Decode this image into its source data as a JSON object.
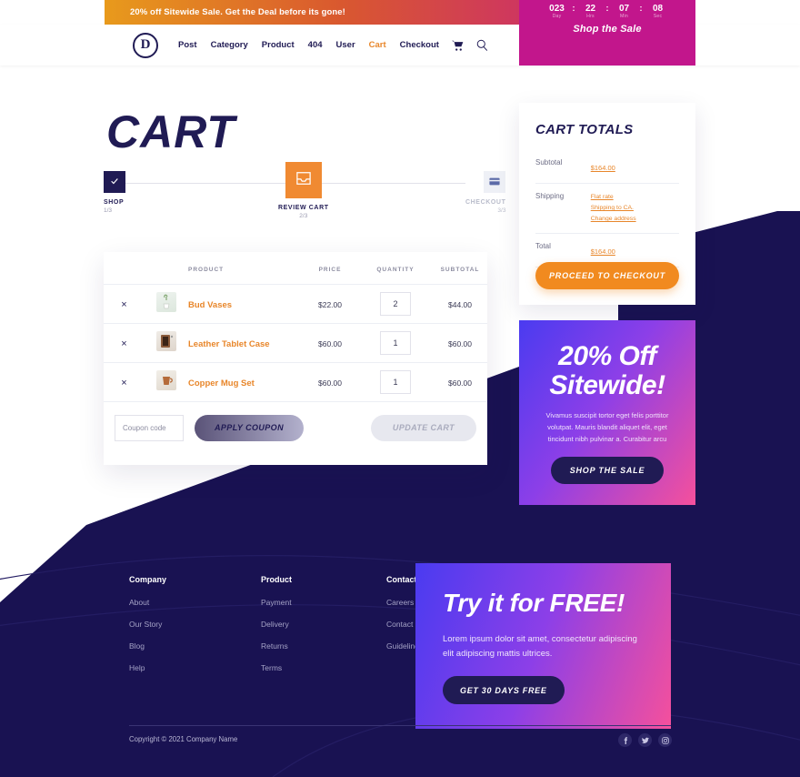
{
  "promo_bar": {
    "text": "20% off Sitewide Sale. Get the Deal before its gone!"
  },
  "countdown": {
    "units": [
      {
        "value": "023",
        "label": "Day"
      },
      {
        "value": "22",
        "label": "Hrs"
      },
      {
        "value": "07",
        "label": "Min"
      },
      {
        "value": "08",
        "label": "Sec"
      }
    ],
    "separator": ":",
    "cta": "Shop the Sale"
  },
  "nav": {
    "logo_letter": "D",
    "links": [
      {
        "label": "Post",
        "active": false
      },
      {
        "label": "Category",
        "active": false
      },
      {
        "label": "Product",
        "active": false
      },
      {
        "label": "404",
        "active": false
      },
      {
        "label": "User",
        "active": false
      },
      {
        "label": "Cart",
        "active": true
      },
      {
        "label": "Checkout",
        "active": false
      }
    ],
    "cart_icon": "shopping-cart-icon",
    "search_icon": "search-icon"
  },
  "page": {
    "title": "CART"
  },
  "steps": [
    {
      "label": "SHOP",
      "sub": "1/3",
      "state": "done",
      "icon": "check-icon"
    },
    {
      "label": "REVIEW CART",
      "sub": "2/3",
      "state": "current",
      "icon": "inbox-icon"
    },
    {
      "label": "CHECKOUT",
      "sub": "3/3",
      "state": "todo",
      "icon": "credit-card-icon"
    }
  ],
  "cart_table": {
    "headers": [
      "",
      "",
      "PRODUCT",
      "PRICE",
      "QUANTITY",
      "SUBTOTAL"
    ],
    "rows": [
      {
        "remove": "×",
        "thumb": "bud-vases-thumb",
        "name": "Bud Vases",
        "price": "$22.00",
        "qty": "2",
        "subtotal": "$44.00"
      },
      {
        "remove": "×",
        "thumb": "leather-tablet-case-thumb",
        "name": "Leather Tablet Case",
        "price": "$60.00",
        "qty": "1",
        "subtotal": "$60.00"
      },
      {
        "remove": "×",
        "thumb": "copper-mug-set-thumb",
        "name": "Copper Mug Set",
        "price": "$60.00",
        "qty": "1",
        "subtotal": "$60.00"
      }
    ]
  },
  "coupon": {
    "placeholder": "Coupon code",
    "value": "",
    "apply_label": "APPLY COUPON",
    "update_label": "UPDATE CART"
  },
  "totals": {
    "title": "CART TOTALS",
    "subtotal_label": "Subtotal",
    "subtotal_value": "$164.00",
    "shipping_label": "Shipping",
    "shipping_method": "Flat rate",
    "shipping_to": "Shipping to CA.",
    "shipping_change": "Change address",
    "total_label": "Total",
    "total_value": "$164.00",
    "checkout_label": "PROCEED TO CHECKOUT"
  },
  "sidebar_promo": {
    "line1": "20% Off",
    "line2": "Sitewide!",
    "body": "Vivamus suscipit tortor eget felis porttitor volutpat. Mauris blandit aliquet elit, eget tincidunt nibh pulvinar a. Curabitur arcu",
    "button": "SHOP THE SALE"
  },
  "footer": {
    "columns": [
      {
        "heading": "Company",
        "links": [
          "About",
          "Our Story",
          "Blog",
          "Help"
        ]
      },
      {
        "heading": "Product",
        "links": [
          "Payment",
          "Delivery",
          "Returns",
          "Terms"
        ]
      },
      {
        "heading": "Contact",
        "links": [
          "Careers",
          "Contact",
          "Guidelines"
        ]
      }
    ],
    "cta": {
      "heading": "Try it for FREE!",
      "body": "Lorem ipsum dolor sit amet, consectetur adipiscing elit adipiscing mattis ultrices.",
      "button": "GET 30 DAYS FREE"
    },
    "copyright": "Copyright © 2021 Company Name",
    "socials": [
      "facebook-icon",
      "twitter-icon",
      "instagram-icon"
    ]
  },
  "colors": {
    "navy": "#191252",
    "deep_navy": "#201b54",
    "orange": "#f18a1f",
    "link_orange": "#e8862a",
    "magenta": "#c2168c",
    "gradient_blue": "#4a3bf0",
    "gradient_pink": "#f5509c"
  }
}
